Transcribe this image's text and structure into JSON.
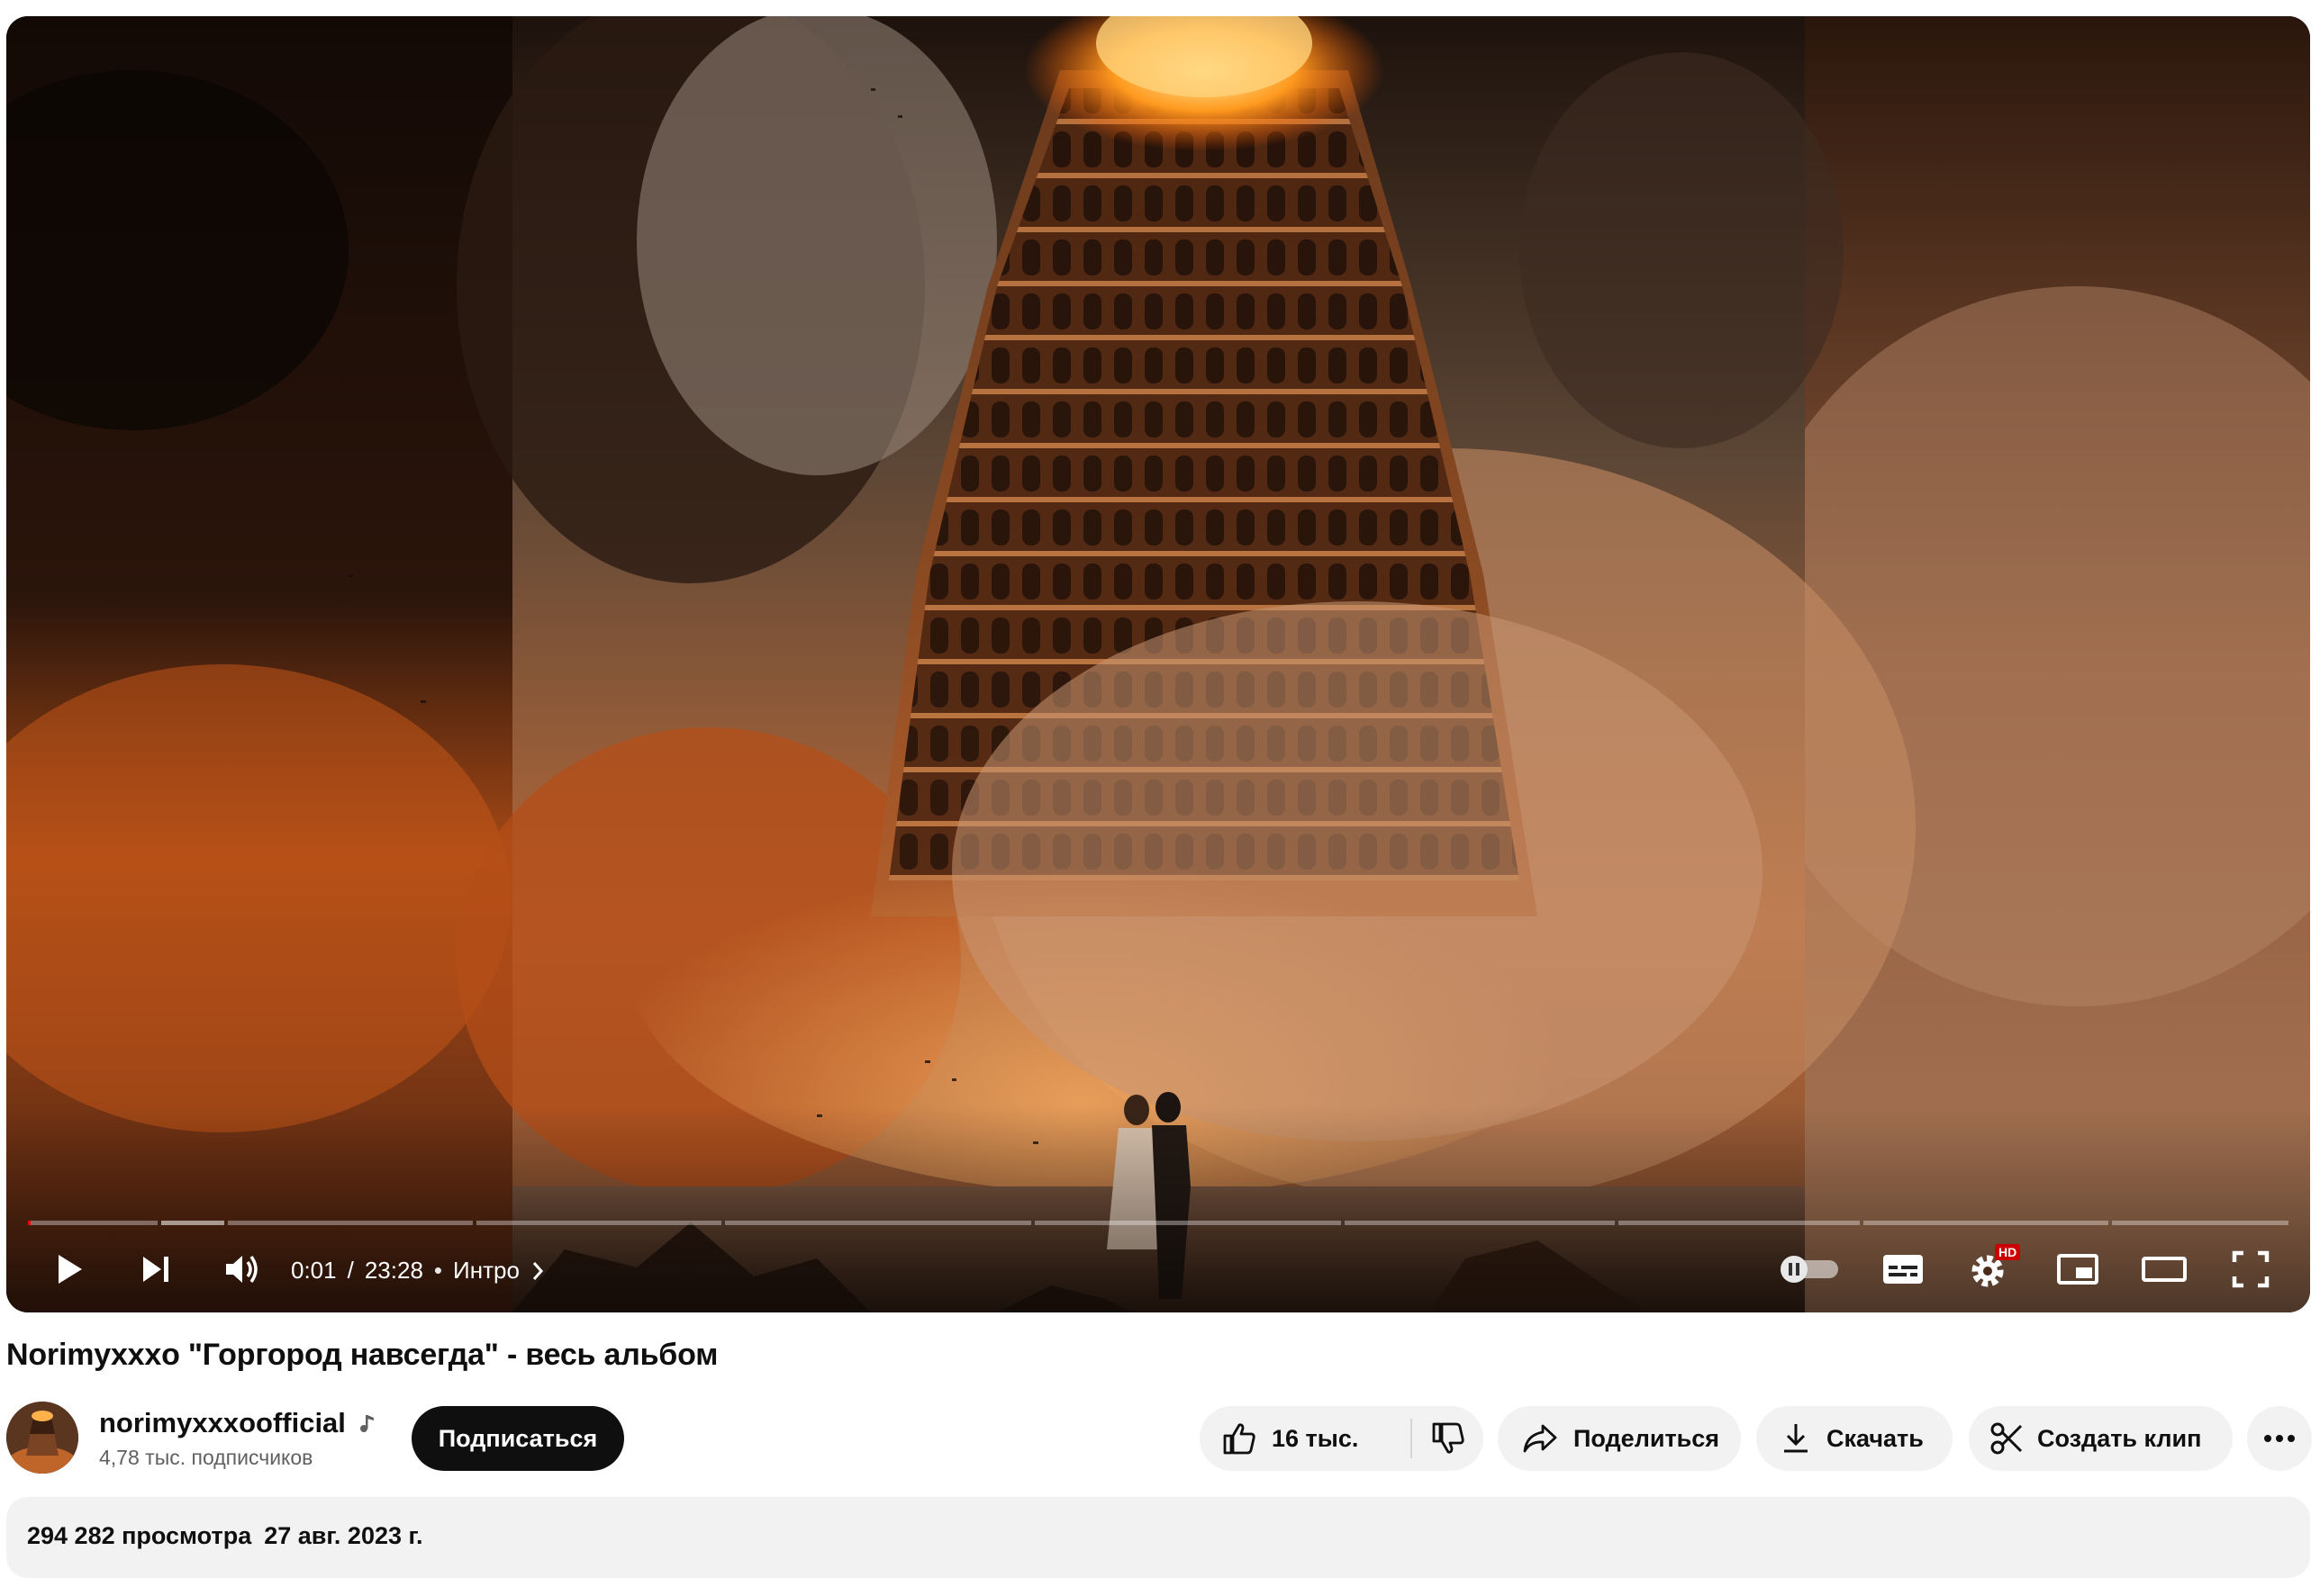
{
  "player": {
    "time_current": "0:01",
    "time_separator": "/",
    "time_total": "23:28",
    "bullet": "•",
    "chapter": "Интро",
    "progress_fraction": 0.0007
  },
  "video": {
    "title": "Norimyxxxo \"Горгород навсегда\" - весь альбом"
  },
  "channel": {
    "name": "norimyxxxoofficial",
    "subscribers": "4,78 тыс. подписчиков",
    "subscribe_label": "Подписаться"
  },
  "actions": {
    "likes": "16 тыс.",
    "share": "Поделиться",
    "download": "Скачать",
    "clip": "Создать клип"
  },
  "description": {
    "views": "294 282 просмотра",
    "date": "27 авг. 2023 г."
  },
  "icons": {
    "quality_badge": "HD",
    "badge_color": "#cc0000"
  }
}
